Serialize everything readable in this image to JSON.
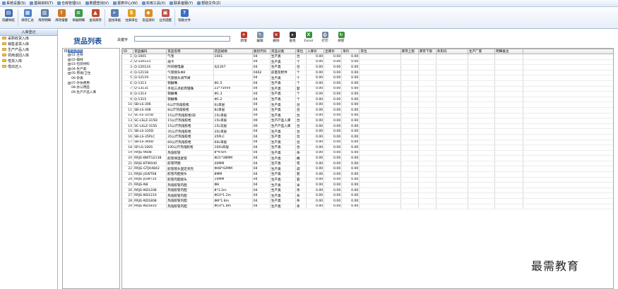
{
  "menubar": {
    "items": [
      {
        "label": "系统设置(S)",
        "icon": "settings-icon"
      },
      {
        "label": "基础资料(T)",
        "icon": "database-icon"
      },
      {
        "label": "仓库管理(U)",
        "icon": "warehouse-icon"
      },
      {
        "label": "数据查询(V)",
        "icon": "query-icon"
      },
      {
        "label": "报表中心(W)",
        "icon": "report-icon"
      },
      {
        "label": "实用工具(X)",
        "icon": "tools-icon"
      },
      {
        "label": "联系客服(Y)",
        "icon": "support-icon"
      },
      {
        "label": "帮助文件(Z)",
        "icon": "help-icon"
      }
    ]
  },
  "toolbar": {
    "items": [
      {
        "label": "隐藏导航",
        "icon": "hide-nav-icon",
        "color": "#3f6fb5",
        "glyph": "▤"
      },
      {
        "label": "库存汇总",
        "icon": "inventory-summary-icon",
        "color": "#4b82c9",
        "glyph": "▦"
      },
      {
        "label": "库存明细",
        "icon": "inventory-detail-icon",
        "color": "#5a7fa8",
        "glyph": "▥"
      },
      {
        "label": "库存报警",
        "icon": "inventory-alarm-icon",
        "color": "#d07a2a",
        "glyph": "!"
      },
      {
        "label": "单据明细",
        "icon": "document-detail-icon",
        "color": "#3d9a4a",
        "glyph": "≡"
      },
      {
        "label": "查询库存",
        "icon": "query-inventory-icon",
        "color": "#c44a2a",
        "glyph": "▲"
      },
      {
        "label": "查找单据",
        "icon": "find-document-icon",
        "color": "#5b7fb2",
        "glyph": "⌕"
      },
      {
        "label": "往来单位",
        "icon": "partners-icon",
        "color": "#e0a020",
        "glyph": "$"
      },
      {
        "label": "货品资料",
        "icon": "goods-info-icon",
        "color": "#e08a20",
        "glyph": "◆"
      },
      {
        "label": "业务提醒",
        "icon": "business-reminder-icon",
        "color": "#c0504d",
        "glyph": "▣"
      },
      {
        "label": "帮助文件",
        "icon": "help-file-icon",
        "color": "#3a6ec1",
        "glyph": "?"
      }
    ]
  },
  "nav": {
    "header": "入库登记",
    "items": [
      {
        "label": "采购收货入库"
      },
      {
        "label": "销售退货入库"
      },
      {
        "label": "生产产品入库"
      },
      {
        "label": "领用退回入库"
      },
      {
        "label": "借货入库"
      },
      {
        "label": "借出还入"
      }
    ]
  },
  "page": {
    "title": "货品列表",
    "keyword_label": "关键字",
    "keyword_value": ""
  },
  "actions": [
    {
      "label": "新增",
      "icon": "add-icon",
      "color": "#c0392b",
      "glyph": "+"
    },
    {
      "label": "编辑",
      "icon": "edit-icon",
      "color": "#7a8fa8",
      "glyph": "✎"
    },
    {
      "label": "删除",
      "icon": "delete-icon",
      "color": "#b03a3a",
      "glyph": "×"
    },
    {
      "label": "查找",
      "icon": "find-icon",
      "color": "#333333",
      "glyph": "⌕"
    },
    {
      "label": "Excel",
      "icon": "excel-icon",
      "color": "#3b8f3b",
      "glyph": "X"
    },
    {
      "label": "打印",
      "icon": "print-icon",
      "color": "#6d7f99",
      "glyph": "⎙"
    },
    {
      "label": "刷新",
      "icon": "refresh-icon",
      "color": "#3b8f3b",
      "glyph": "↻"
    }
  ],
  "tree": {
    "root": "货品类别",
    "items": [
      {
        "label": "01-主材",
        "expandable": true
      },
      {
        "label": "02-辅材",
        "expandable": true
      },
      {
        "label": "03-包装材料",
        "expandable": true
      },
      {
        "label": "04-生产类",
        "expandable": true
      },
      {
        "label": "05-劳保/卫生",
        "expandable": true
      },
      {
        "label": "06-杂类",
        "expandable": false
      },
      {
        "label": "07-外协费用",
        "expandable": true
      },
      {
        "label": "08-办公用品",
        "expandable": false
      },
      {
        "label": "09-生产产品入库",
        "expandable": false
      }
    ]
  },
  "grid": {
    "columns": [
      "ID",
      "货品编码",
      "货品名称",
      "货品规格",
      "类别代码",
      "货品分类",
      "单位",
      "入库价",
      "出库价",
      "单价",
      "货位",
      "库存上限",
      "库存下限",
      "条形码",
      "生产厂家",
      "明细备注"
    ],
    "rows": [
      [
        "1",
        "Q-1001",
        "气泵",
        "1001",
        "04",
        "生产类",
        "台",
        "0.00",
        "0.00",
        "0.00",
        "",
        "",
        "",
        "",
        "",
        ""
      ],
      [
        "2",
        "Q-120123",
        "线卡",
        "",
        "04",
        "生产类",
        "个",
        "0.00",
        "0.00",
        "0.00",
        "",
        "",
        "",
        "",
        "",
        ""
      ],
      [
        "3",
        "Q-120124",
        "时间继电器",
        "SJ1307",
        "04",
        "生产类",
        "台",
        "0.00",
        "0.00",
        "0.00",
        "",
        "",
        "",
        "",
        "",
        ""
      ],
      [
        "4",
        "Q-12118",
        "气管接头Φ8",
        "",
        "0402",
        "前量及附件",
        "个",
        "0.00",
        "0.00",
        "0.00",
        "",
        "",
        "",
        "",
        "",
        ""
      ],
      [
        "5",
        "Q-12119",
        "气管接头调节阀",
        "",
        "04",
        "生产类",
        "个",
        "0.00",
        "0.00",
        "0.00",
        "",
        "",
        "",
        "",
        "",
        ""
      ],
      [
        "6",
        "Q-1313",
        "铜触嘴",
        "Φ1.5",
        "04",
        "生产类",
        "个",
        "0.00",
        "0.00",
        "0.00",
        "",
        "",
        "",
        "",
        "",
        ""
      ],
      [
        "7",
        "Q-13131",
        "手动三点拆焊钳嘴",
        "22*75mm",
        "04",
        "生产类",
        "套",
        "0.00",
        "0.00",
        "0.00",
        "",
        "",
        "",
        "",
        "",
        ""
      ],
      [
        "8",
        "Q-1314",
        "铜触嘴",
        "Φ1.3",
        "04",
        "生产类",
        "个",
        "0.00",
        "0.00",
        "0.00",
        "",
        "",
        "",
        "",
        "",
        ""
      ],
      [
        "9",
        "Q-1315",
        "铜触嘴",
        "Φ1.2",
        "04",
        "生产类",
        "个",
        "0.00",
        "0.00",
        "0.00",
        "",
        "",
        "",
        "",
        "",
        ""
      ],
      [
        "10",
        "SB-LS-306",
        "6公斤热熔胶枪",
        "6L单层",
        "04",
        "生产类",
        "台",
        "0.00",
        "0.00",
        "0.00",
        "",
        "",
        "",
        "",
        "",
        ""
      ],
      [
        "11",
        "SB-LS-308",
        "8公斤热熔胶枪",
        "8L单层",
        "04",
        "生产类",
        "台",
        "0.00",
        "0.00",
        "0.00",
        "",
        "",
        "",
        "",
        "",
        ""
      ],
      [
        "12",
        "SC-LS-315D",
        "15公斤热熔胶枪/旧",
        "15L单层",
        "04",
        "生产类",
        "台",
        "0.00",
        "0.00",
        "0.00",
        "",
        "",
        "",
        "",
        "",
        ""
      ],
      [
        "13",
        "SC-LSLZ-315D",
        "15公斤热熔胶枪",
        "15L单层",
        "09",
        "生产产品入库",
        "台",
        "0.00",
        "0.00",
        "0.00",
        "",
        "",
        "",
        "",
        "",
        ""
      ],
      [
        "14",
        "SC-LSLZ-315S",
        "15公斤热熔胶枪",
        "15L双层",
        "09",
        "生产产品入库",
        "台",
        "0.00",
        "0.00",
        "0.00",
        "",
        "",
        "",
        "",
        "",
        ""
      ],
      [
        "15",
        "SB-LS-335D",
        "35公斤热熔胶枪",
        "35L单层",
        "04",
        "生产类",
        "台",
        "0.00",
        "0.00",
        "0.00",
        "",
        "",
        "",
        "",
        "",
        ""
      ],
      [
        "16",
        "SB-LS-35PLC",
        "35公斤热熔胶枪",
        "35PLC",
        "04",
        "生产类",
        "台",
        "0.00",
        "0.00",
        "0.00",
        "",
        "",
        "",
        "",
        "",
        ""
      ],
      [
        "17",
        "SB-LS-360D",
        "60公斤热熔胶枪",
        "60L单层",
        "04",
        "生产类",
        "台",
        "0.00",
        "0.00",
        "0.00",
        "",
        "",
        "",
        "",
        "",
        ""
      ],
      [
        "18",
        "SP-LS-100S",
        "100公斤热熔胶枪",
        "100L四层",
        "04",
        "生产类",
        "台",
        "0.00",
        "0.00",
        "0.00",
        "",
        "",
        "",
        "",
        "",
        ""
      ],
      [
        "19",
        "RRJG-9608",
        "热熔胶管",
        "8*9.6m",
        "04",
        "生产类",
        "条",
        "0.00",
        "0.00",
        "0.00",
        "",
        "",
        "",
        "",
        "",
        ""
      ],
      [
        "20",
        "RRJG-BWTG2138",
        "胶管保温套管",
        "Φ21*38MM",
        "04",
        "生产类",
        "桶",
        "0.00",
        "0.00",
        "0.00",
        "",
        "",
        "",
        "",
        "",
        ""
      ],
      [
        "21",
        "RRJG-BTW040",
        "胶管环圈",
        "40MM",
        "04",
        "生产类",
        "卷",
        "0.00",
        "0.00",
        "0.00",
        "",
        "",
        "",
        "",
        "",
        ""
      ],
      [
        "22",
        "RRJG-GTJH4842",
        "胶管管头固定夹壳",
        "Φ48*42MM",
        "04",
        "生产类",
        "袋",
        "0.00",
        "0.00",
        "0.00",
        "",
        "",
        "",
        "",
        "",
        ""
      ],
      [
        "23",
        "RRJG-JGWT08",
        "胶管内胆接头",
        "8MM",
        "04",
        "生产类",
        "套",
        "0.00",
        "0.00",
        "0.00",
        "",
        "",
        "",
        "",
        "",
        ""
      ],
      [
        "24",
        "RRJG-JGWT10",
        "胶管内胆接头",
        "10MM",
        "04",
        "生产类",
        "套",
        "0.00",
        "0.00",
        "0.00",
        "",
        "",
        "",
        "",
        "",
        ""
      ],
      [
        "25",
        "RRJG-N8",
        "热熔胶管内胆",
        "Φ8",
        "04",
        "生产类",
        "米",
        "0.00",
        "0.00",
        "0.00",
        "",
        "",
        "",
        "",
        "",
        ""
      ],
      [
        "26",
        "RRJG-ND1208",
        "热熔胶管内胆",
        "8*1.2m",
        "04",
        "生产类",
        "条",
        "0.00",
        "0.00",
        "0.00",
        "",
        "",
        "",
        "",
        "",
        ""
      ],
      [
        "27",
        "RRJG-ND1210",
        "热熔胶管内胆",
        "Φ10*1.2m",
        "04",
        "生产类",
        "条",
        "0.00",
        "0.00",
        "0.00",
        "",
        "",
        "",
        "",
        "",
        ""
      ],
      [
        "28",
        "RRJG-ND1808",
        "热熔胶管内胆",
        "Φ8*1.8m",
        "04",
        "生产类",
        "条",
        "0.00",
        "0.00",
        "0.00",
        "",
        "",
        "",
        "",
        "",
        ""
      ],
      [
        "29",
        "RRJG-ND1810",
        "热熔胶管内胆",
        "Φ10*1.8m",
        "04",
        "生产类",
        "条",
        "0.00",
        "0.00",
        "0.00",
        "",
        "",
        "",
        "",
        "",
        ""
      ]
    ]
  },
  "watermark": "最需教育"
}
